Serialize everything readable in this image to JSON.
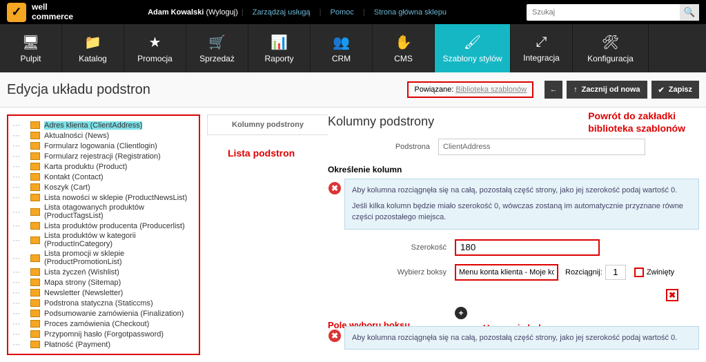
{
  "topbar": {
    "logo_top": "well",
    "logo_bottom": "commerce",
    "user": "Adam Kowalski",
    "logout": "(Wyloguj)",
    "link1": "Zarządzaj usługą",
    "link2": "Pomoc",
    "link3": "Strona główna sklepu",
    "search_placeholder": "Szukaj"
  },
  "nav": {
    "items": [
      "Pulpit",
      "Katalog",
      "Promocja",
      "Sprzedaż",
      "Raporty",
      "CRM",
      "CMS",
      "Szablony stylów",
      "Integracja",
      "Konfiguracja"
    ]
  },
  "page": {
    "title": "Edycja układu podstron",
    "related_label": "Powiązane:",
    "related_link": "Biblioteka szablonów",
    "btn_new": "Zacznij od nowa",
    "btn_save": "Zapisz"
  },
  "tree": [
    "Adres klienta (ClientAddress)",
    "Aktualności (News)",
    "Formularz logowania (Clientlogin)",
    "Formularz rejestracji (Registration)",
    "Karta produktu (Product)",
    "Kontakt (Contact)",
    "Koszyk (Cart)",
    "Lista nowości w sklepie (ProductNewsList)",
    "Lista otagowanych produktów (ProductTagsList)",
    "Lista produktów producenta (Producerlist)",
    "Lista produktów w kategorii (ProductInCategory)",
    "Lista promocji w sklepie (ProductPromotionList)",
    "Lista życzeń (Wishlist)",
    "Mapa strony (Sitemap)",
    "Newsletter (Newsletter)",
    "Podstrona statyczna (Staticcms)",
    "Podsumowanie zamówienia (Finalization)",
    "Proces zamówienia (Checkout)",
    "Przypomnij hasło (Forgotpassword)",
    "Płatność (Payment)"
  ],
  "mid": {
    "tab": "Kolumny podstrony"
  },
  "panel": {
    "title": "Kolumny podstrony",
    "subpage_label": "Podstrona",
    "subpage_value": "ClientAddress",
    "columns_section": "Określenie kolumn",
    "info1_line1": "Aby kolumna rozciągnęła się na całą, pozostałą część strony, jako jej szerokość podaj wartość 0.",
    "info1_line2": "Jeśli kilka kolumn będzie miało szerokość 0, wówczas zostaną im automatycznie przyznane równe części pozostałego miejsca.",
    "width_label": "Szerokość",
    "width_value": "180",
    "select_box_label": "Wybierz boksy",
    "select_box_value": "Menu konta klienta - Moje ko",
    "stretch_label": "Rozciągnij:",
    "stretch_value": "1",
    "collapsed_label": "Zwinięty",
    "info2": "Aby kolumna rozciągnęła się na całą, pozostałą część strony, jako jej szerokość podaj wartość 0."
  },
  "annotations": {
    "lista": "Lista podstron",
    "powrot1": "Powrót do zakładki",
    "powrot2": "biblioteka szablonów",
    "pole": "Pole wyboru boksu",
    "usuw": "Usuwanie boksu"
  }
}
